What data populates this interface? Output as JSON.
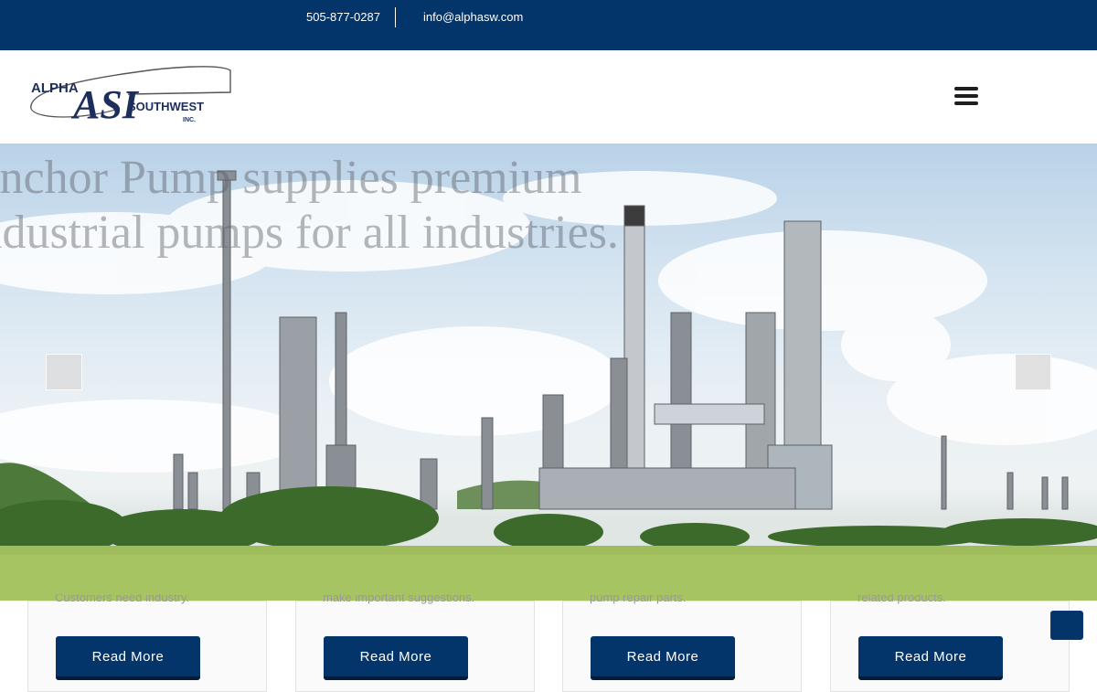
{
  "topbar": {
    "phone": "505-877-0287",
    "email": "info@alphasw.com"
  },
  "header": {
    "logo": {
      "word_left": "ALPHA",
      "monogram": "ASI",
      "word_right": "SOUTHWEST",
      "suffix": "INC."
    },
    "menu_icon": "hamburger-menu-icon"
  },
  "hero": {
    "heading_line1": "Anchor Pump supplies premium",
    "heading_line2": "industrial pumps for all industries.",
    "prev_icon": "chevron-left-icon",
    "next_icon": "chevron-right-icon"
  },
  "cards": [
    {
      "snippet": "Customers need industry.",
      "button": "Read More"
    },
    {
      "snippet": "make important suggestions.",
      "button": "Read More"
    },
    {
      "snippet": "pump repair parts.",
      "button": "Read More"
    },
    {
      "snippet": "related products.",
      "button": "Read More"
    }
  ],
  "scroll_top_icon": "arrow-up-icon",
  "colors": {
    "brand_navy": "#03346a",
    "white": "#ffffff"
  }
}
